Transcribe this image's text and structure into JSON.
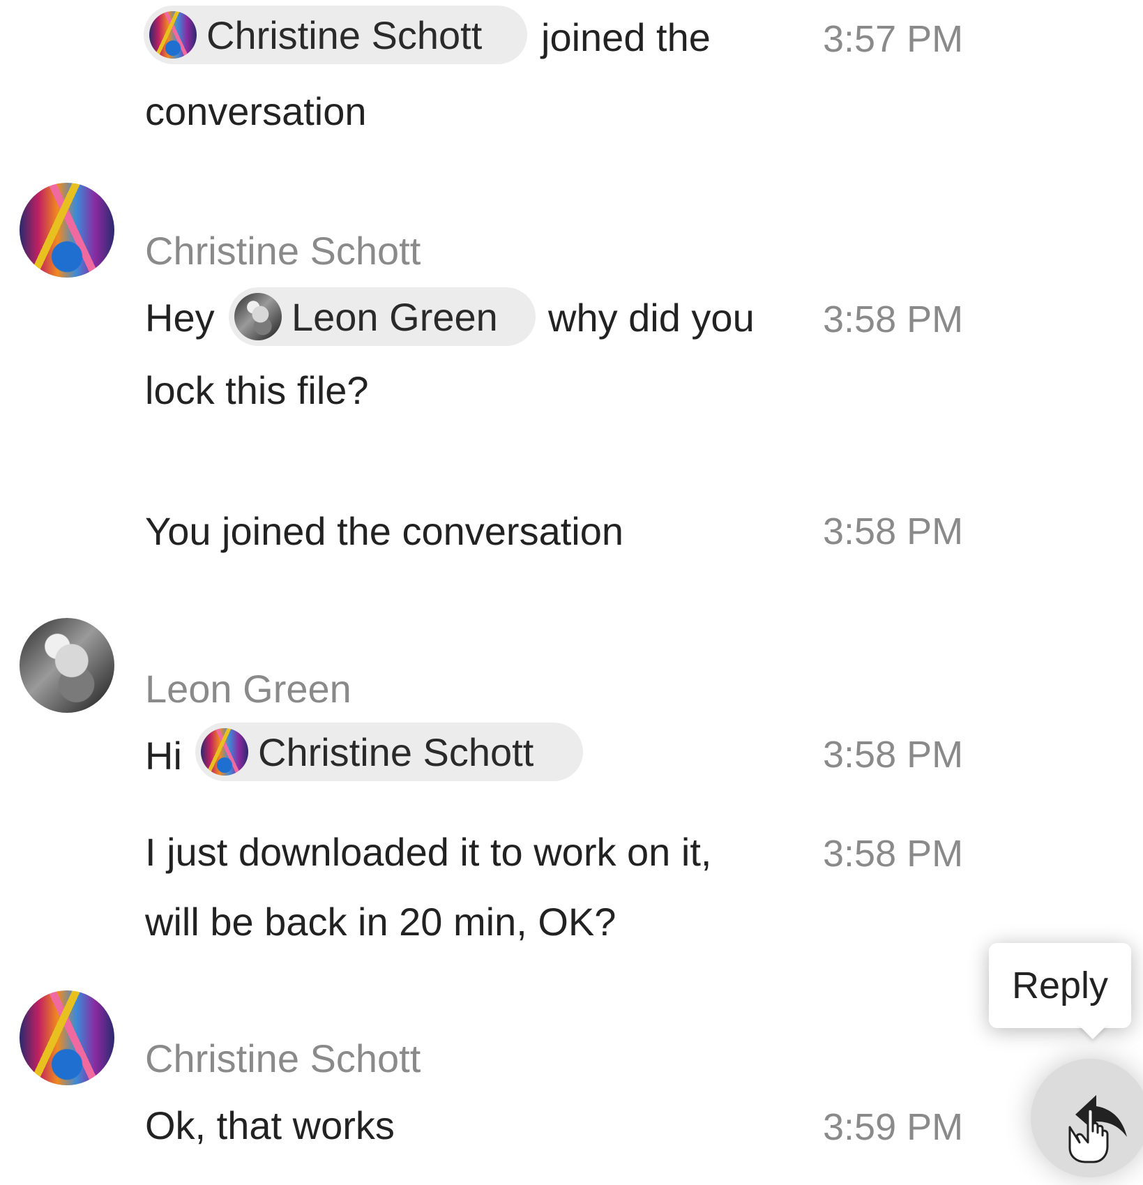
{
  "messages": {
    "sys_joined_christine": {
      "mention": "Christine Schott",
      "line1": "joined the",
      "line2": "conversation",
      "time": "3:57 PM"
    },
    "christine_msg1": {
      "author": "Christine Schott",
      "prefix": "Hey",
      "mention": "Leon Green",
      "line1_suffix": "why did you",
      "line2": "lock this file?",
      "time": "3:58 PM"
    },
    "sys_joined_you": {
      "text": "You joined the conversation",
      "time": "3:58 PM"
    },
    "leon_msg1": {
      "author": "Leon Green",
      "prefix": "Hi",
      "mention": "Christine Schott",
      "time": "3:58 PM"
    },
    "leon_msg2": {
      "line1": "I just downloaded it to work on it,",
      "line2": "will be back in 20 min, OK?",
      "time": "3:58 PM"
    },
    "christine_msg2": {
      "author": "Christine Schott",
      "text": "Ok, that works",
      "time": "3:59 PM"
    }
  },
  "tooltip": {
    "label": "Reply"
  },
  "icons": {
    "reply": "reply-icon",
    "cursor": "hand-cursor-icon"
  }
}
